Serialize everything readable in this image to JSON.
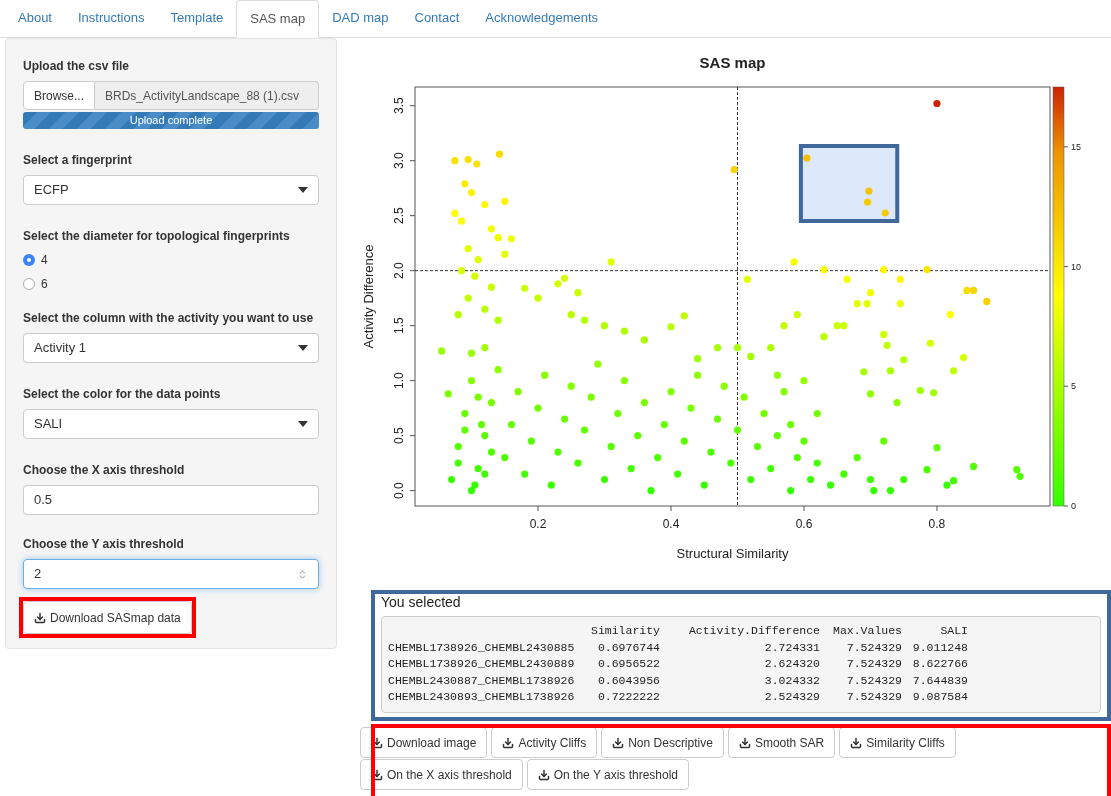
{
  "tabs": [
    {
      "label": "About",
      "selected": false
    },
    {
      "label": "Instructions",
      "selected": false
    },
    {
      "label": "Template",
      "selected": false
    },
    {
      "label": "SAS map",
      "selected": true
    },
    {
      "label": "DAD map",
      "selected": false
    },
    {
      "label": "Contact",
      "selected": false
    },
    {
      "label": "Acknowledgements",
      "selected": false
    }
  ],
  "sidebar": {
    "upload": {
      "label": "Upload the csv file",
      "button": "Browse...",
      "file_name": "BRDs_ActivityLandscape_88 (1).csv",
      "progress": {
        "level": 1,
        "text": "Upload complete"
      }
    },
    "fingerprint": {
      "label": "Select a fingerprint",
      "value": "ECFP"
    },
    "diameter": {
      "label": "Select the diameter for topological fingerprints",
      "options": [
        {
          "label": "4",
          "selected": true
        },
        {
          "label": "6",
          "selected": false
        }
      ]
    },
    "activity_column": {
      "label": "Select the column with the activity you want to use",
      "value": "Activity 1"
    },
    "point_color": {
      "label": "Select the color for the data points",
      "value": "SALI"
    },
    "x_threshold": {
      "label": "Choose the X axis threshold",
      "value": "0.5"
    },
    "y_threshold": {
      "label": "Choose the Y axis threshold",
      "value": "2",
      "focused": true
    },
    "download_button": {
      "label": "Download SASmap data"
    }
  },
  "chart": {
    "chart_data": {
      "type": "scatter",
      "title": "SAS map",
      "xlabel": "Structural Similarity",
      "ylabel": "Activity Difference",
      "xlim": [
        0.015,
        0.97
      ],
      "ylim": [
        -0.14,
        3.67
      ],
      "xticks": [
        {
          "value": 0.2,
          "label": "0.2"
        },
        {
          "value": 0.4,
          "label": "0.4"
        },
        {
          "value": 0.6,
          "label": "0.6"
        },
        {
          "value": 0.8,
          "label": "0.8"
        }
      ],
      "yticks": [
        {
          "value": 0,
          "label": "0.0"
        },
        {
          "value": 0.5,
          "label": "0.5"
        },
        {
          "value": 1,
          "label": "1.0"
        },
        {
          "value": 1.5,
          "label": "1.5"
        },
        {
          "value": 2,
          "label": "2.0"
        },
        {
          "value": 2.5,
          "label": "2.5"
        },
        {
          "value": 3,
          "label": "3.0"
        },
        {
          "value": 3.5,
          "label": "3.5"
        }
      ],
      "x": [
        0.6977,
        0.6957,
        0.6044,
        0.7222,
        0.8,
        0.495,
        0.31,
        0.585,
        0.63,
        0.72,
        0.785,
        0.515,
        0.665,
        0.745,
        0.845,
        0.855,
        0.875,
        0.7,
        0.68,
        0.695,
        0.745,
        0.82,
        0.59,
        0.65,
        0.66,
        0.57,
        0.63,
        0.72,
        0.725,
        0.79,
        0.84,
        0.75,
        0.73,
        0.825,
        0.69,
        0.775,
        0.795,
        0.7,
        0.74,
        0.8,
        0.855,
        0.785,
        0.92,
        0.925,
        0.825,
        0.815,
        0.73,
        0.705,
        0.075,
        0.095,
        0.108,
        0.142,
        0.09,
        0.1,
        0.075,
        0.085,
        0.12,
        0.15,
        0.13,
        0.14,
        0.16,
        0.095,
        0.11,
        0.15,
        0.085,
        0.105,
        0.13,
        0.095,
        0.12,
        0.08,
        0.14,
        0.055,
        0.065,
        0.18,
        0.2,
        0.23,
        0.24,
        0.26,
        0.25,
        0.27,
        0.3,
        0.33,
        0.36,
        0.42,
        0.4,
        0.44,
        0.47,
        0.5,
        0.52,
        0.55,
        0.56,
        0.6,
        0.62,
        0.58,
        0.07,
        0.08,
        0.09,
        0.1,
        0.11,
        0.12,
        0.13,
        0.14,
        0.1,
        0.15,
        0.16,
        0.17,
        0.18,
        0.19,
        0.2,
        0.21,
        0.22,
        0.23,
        0.24,
        0.25,
        0.26,
        0.27,
        0.28,
        0.29,
        0.3,
        0.31,
        0.32,
        0.33,
        0.34,
        0.35,
        0.36,
        0.37,
        0.38,
        0.39,
        0.4,
        0.41,
        0.42,
        0.43,
        0.44,
        0.45,
        0.46,
        0.47,
        0.48,
        0.49,
        0.5,
        0.51,
        0.52,
        0.53,
        0.54,
        0.55,
        0.56,
        0.57,
        0.58,
        0.59,
        0.6,
        0.61,
        0.62,
        0.64,
        0.66,
        0.68,
        0.7,
        0.72,
        0.75,
        0.08,
        0.09,
        0.11,
        0.12,
        0.13,
        0.1,
        0.12,
        0.115,
        0.105
      ],
      "series": [
        {
          "values": [
            2.7243,
            2.6243,
            3.0243,
            2.5243,
            3.52,
            2.92,
            2.08,
            2.08,
            2.01,
            2.01,
            2.01,
            1.92,
            1.92,
            1.92,
            1.82,
            1.82,
            1.72,
            1.8,
            1.7,
            1.7,
            1.7,
            1.6,
            1.6,
            1.5,
            1.5,
            1.5,
            1.4,
            1.42,
            1.32,
            1.34,
            1.21,
            1.19,
            1.09,
            1.09,
            1.08,
            0.91,
            0.89,
            0.88,
            0.8,
            0.39,
            0.22,
            0.19,
            0.19,
            0.13,
            0.09,
            0.05,
            0.0,
            0.0,
            3.0,
            3.01,
            2.97,
            3.06,
            2.79,
            2.71,
            2.52,
            2.45,
            2.6,
            2.63,
            2.38,
            2.3,
            2.29,
            2.2,
            2.1,
            2.15,
            2.0,
            1.95,
            1.85,
            1.75,
            1.65,
            1.6,
            1.55,
            1.27,
            0.88,
            1.84,
            1.75,
            1.88,
            1.93,
            1.8,
            1.6,
            1.55,
            1.5,
            1.45,
            1.37,
            1.59,
            1.49,
            1.2,
            1.3,
            1.3,
            1.22,
            1.3,
            1.05,
            1.0,
            0.7,
            0.6,
            0.1,
            0.4,
            0.7,
            1.0,
            0.2,
            0.5,
            0.8,
            1.1,
            0.0,
            0.3,
            0.6,
            0.9,
            0.15,
            0.45,
            0.75,
            1.05,
            0.05,
            0.35,
            0.65,
            0.95,
            0.25,
            0.55,
            0.85,
            1.15,
            0.1,
            0.4,
            0.7,
            1.0,
            0.2,
            0.5,
            0.8,
            0.0,
            0.3,
            0.6,
            0.9,
            0.15,
            0.45,
            0.75,
            1.05,
            0.05,
            0.35,
            0.65,
            0.95,
            0.25,
            0.55,
            0.85,
            0.1,
            0.4,
            0.7,
            0.2,
            0.5,
            0.9,
            0.0,
            0.3,
            0.45,
            0.1,
            0.25,
            0.05,
            0.15,
            0.3,
            0.1,
            0.45,
            0.1,
            0.25,
            0.55,
            0.85,
            0.15,
            0.35,
            1.25,
            1.3,
            0.6,
            0.05
          ]
        }
      ]
    },
    "color_scale": {
      "ticks": [
        "15",
        "10",
        "5",
        "0"
      ]
    }
  },
  "selection_output": {
    "heading": "You selected",
    "columns": [
      "Similarity",
      "Activity.Difference",
      "Max.Values",
      "SALI"
    ],
    "rows": [
      {
        "label": "CHEMBL1738926_CHEMBL2430885",
        "cells": [
          "0.6976744",
          "2.724331",
          "7.524329",
          "9.011248"
        ]
      },
      {
        "label": "CHEMBL1738926_CHEMBL2430889",
        "cells": [
          "0.6956522",
          "2.624320",
          "7.524329",
          "8.622766"
        ]
      },
      {
        "label": "CHEMBL2430887_CHEMBL1738926",
        "cells": [
          "0.6043956",
          "3.024332",
          "7.524329",
          "7.644839"
        ]
      },
      {
        "label": "CHEMBL2430893_CHEMBL1738926",
        "cells": [
          "0.7222222",
          "2.524329",
          "7.524329",
          "9.087584"
        ]
      }
    ]
  },
  "download_buttons": {
    "rows": [
      [
        "Download image",
        "Activity Cliffs",
        "Non Descriptive",
        "Smooth SAR",
        "Similarity Cliffs"
      ],
      [
        "On the X axis threshold",
        "On the Y axis threshold"
      ]
    ]
  }
}
